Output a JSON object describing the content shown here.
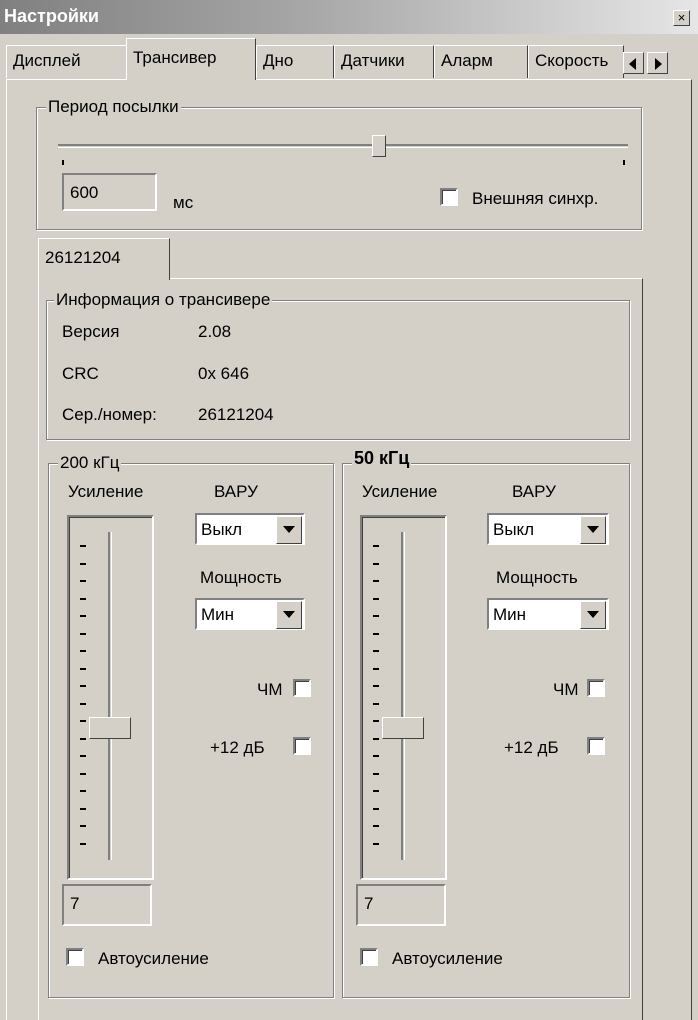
{
  "window": {
    "title": "Настройки",
    "close": "×"
  },
  "tabs": [
    "Дисплей",
    "Трансивер",
    "Дно",
    "Датчики",
    "Аларм",
    "Скорость"
  ],
  "ping": {
    "legend": "Период посылки",
    "value": "600",
    "unit": "мс",
    "slider_fraction": 0.55,
    "ext_sync_label": "Внешняя синхр."
  },
  "device_tab": "26121204",
  "info": {
    "legend": "Информация о трансивере",
    "rows": [
      {
        "label": "Версия",
        "value": "2.08"
      },
      {
        "label": "CRC",
        "value": "0x 646"
      },
      {
        "label": "Сер./номер:",
        "value": "26121204"
      }
    ]
  },
  "channels": [
    {
      "legend": "200 кГц",
      "gain_label": "Усиление",
      "vary_label": "ВАРУ",
      "vary_value": "Выкл",
      "power_label": "Мощность",
      "power_value": "Мин",
      "fm_label": "ЧМ",
      "boost_label": "+12 дБ",
      "gain_value": "7",
      "auto_gain_label": "Автоусиление"
    },
    {
      "legend": "50 кГц",
      "gain_label": "Усиление",
      "vary_label": "ВАРУ",
      "vary_value": "Выкл",
      "power_label": "Мощность",
      "power_value": "Мин",
      "fm_label": "ЧМ",
      "boost_label": "+12 дБ",
      "gain_value": "7",
      "auto_gain_label": "Автоусиление"
    }
  ]
}
